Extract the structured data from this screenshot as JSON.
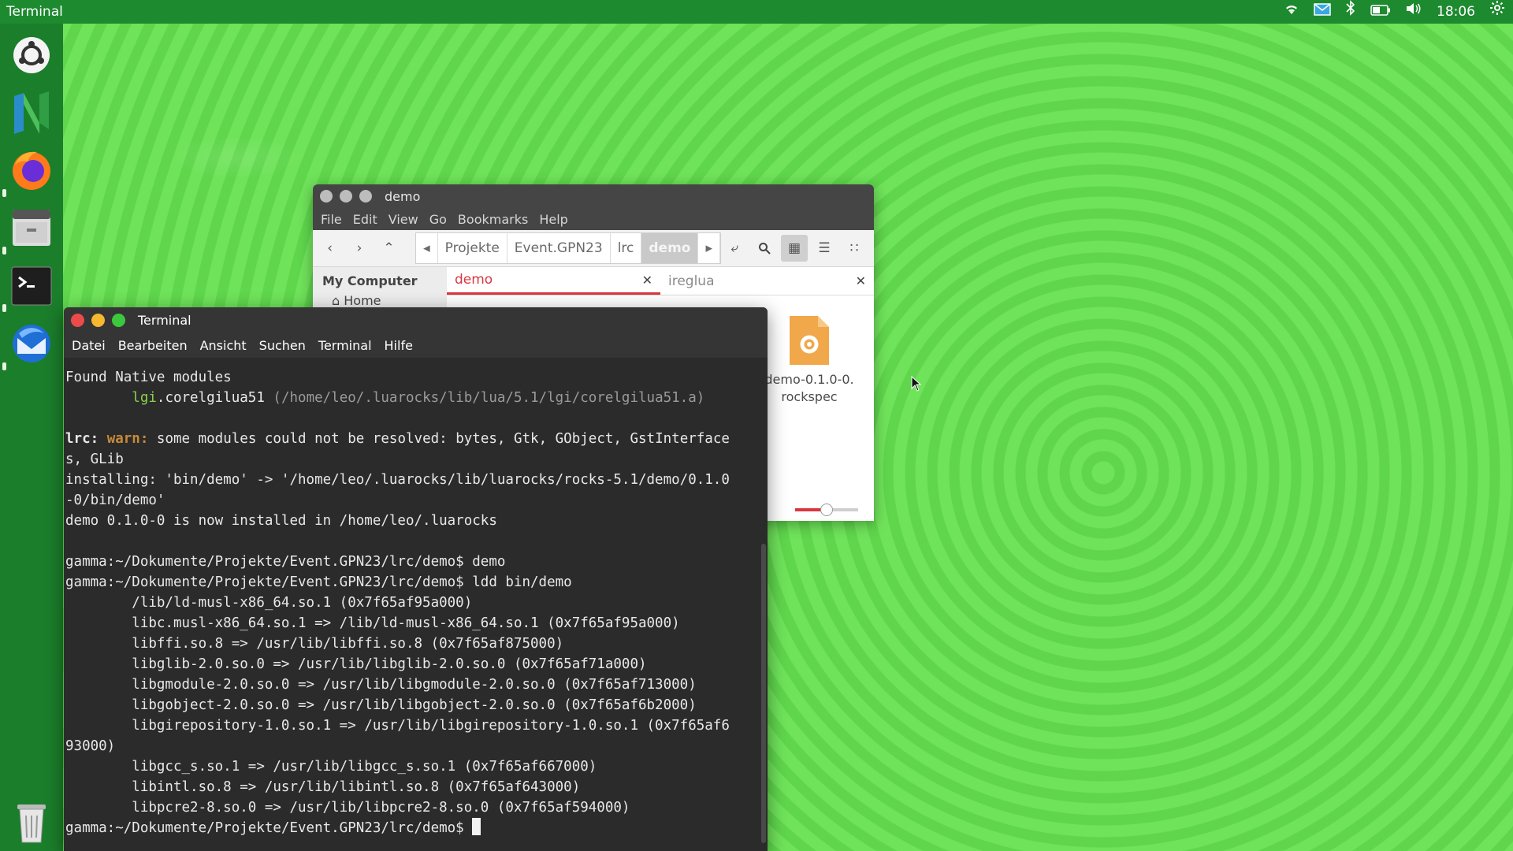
{
  "top_panel": {
    "app_title": "Terminal",
    "clock": "18:06",
    "tray_icons": [
      "wifi-icon",
      "mail-icon",
      "bluetooth-icon",
      "battery-icon",
      "volume-icon",
      "settings-icon"
    ]
  },
  "dock": {
    "items": [
      {
        "name": "ubuntu-icon"
      },
      {
        "name": "app-n-icon"
      },
      {
        "name": "firefox-icon"
      },
      {
        "name": "file-manager-icon"
      },
      {
        "name": "terminal-icon"
      },
      {
        "name": "thunderbird-icon"
      },
      {
        "name": "trash-icon"
      }
    ]
  },
  "file_manager": {
    "title": "demo",
    "menu": [
      "File",
      "Edit",
      "View",
      "Go",
      "Bookmarks",
      "Help"
    ],
    "breadcrumbs": [
      "Projekte",
      "Event.GPN23",
      "lrc",
      "demo"
    ],
    "sidebar": {
      "heading": "My Computer",
      "items": [
        "Home"
      ]
    },
    "tabs": [
      {
        "label": "demo"
      },
      {
        "label": "ireglua"
      }
    ],
    "file": {
      "name_line1": "demo-0.1.0-0.",
      "name_line2": "rockspec"
    },
    "accent": "#d9363e"
  },
  "terminal": {
    "title": "Terminal",
    "menu": [
      "Datei",
      "Bearbeiten",
      "Ansicht",
      "Suchen",
      "Terminal",
      "Hilfe"
    ],
    "lines": {
      "l1": "Found Native modules",
      "l2_indent": "        ",
      "l2_a": "lgi",
      "l2_b": ".corelgilua51 ",
      "l2_c": "(/home/leo/.luarocks/lib/lua/5.1/lgi/corelgilua51.a)",
      "l4_a": "lrc:",
      "l4_b": " ",
      "l4_c": "warn:",
      "l4_d": " some modules could not be resolved: bytes, Gtk, GObject, GstInterface",
      "l5": "s, GLib",
      "l6": "installing: 'bin/demo' -> '/home/leo/.luarocks/lib/luarocks/rocks-5.1/demo/0.1.0",
      "l7": "-0/bin/demo'",
      "l8": "demo 0.1.0-0 is now installed in /home/leo/.luarocks",
      "l10": "gamma:~/Dokumente/Projekte/Event.GPN23/lrc/demo$ demo",
      "l11": "gamma:~/Dokumente/Projekte/Event.GPN23/lrc/demo$ ldd bin/demo",
      "l12": "        /lib/ld-musl-x86_64.so.1 (0x7f65af95a000)",
      "l13": "        libc.musl-x86_64.so.1 => /lib/ld-musl-x86_64.so.1 (0x7f65af95a000)",
      "l14": "        libffi.so.8 => /usr/lib/libffi.so.8 (0x7f65af875000)",
      "l15": "        libglib-2.0.so.0 => /usr/lib/libglib-2.0.so.0 (0x7f65af71a000)",
      "l16": "        libgmodule-2.0.so.0 => /usr/lib/libgmodule-2.0.so.0 (0x7f65af713000)",
      "l17": "        libgobject-2.0.so.0 => /usr/lib/libgobject-2.0.so.0 (0x7f65af6b2000)",
      "l18": "        libgirepository-1.0.so.1 => /usr/lib/libgirepository-1.0.so.1 (0x7f65af6",
      "l19": "93000)",
      "l20": "        libgcc_s.so.1 => /usr/lib/libgcc_s.so.1 (0x7f65af667000)",
      "l21": "        libintl.so.8 => /usr/lib/libintl.so.8 (0x7f65af643000)",
      "l22": "        libpcre2-8.so.0 => /usr/lib/libpcre2-8.so.0 (0x7f65af594000)",
      "l23": "gamma:~/Dokumente/Projekte/Event.GPN23/lrc/demo$ "
    }
  }
}
